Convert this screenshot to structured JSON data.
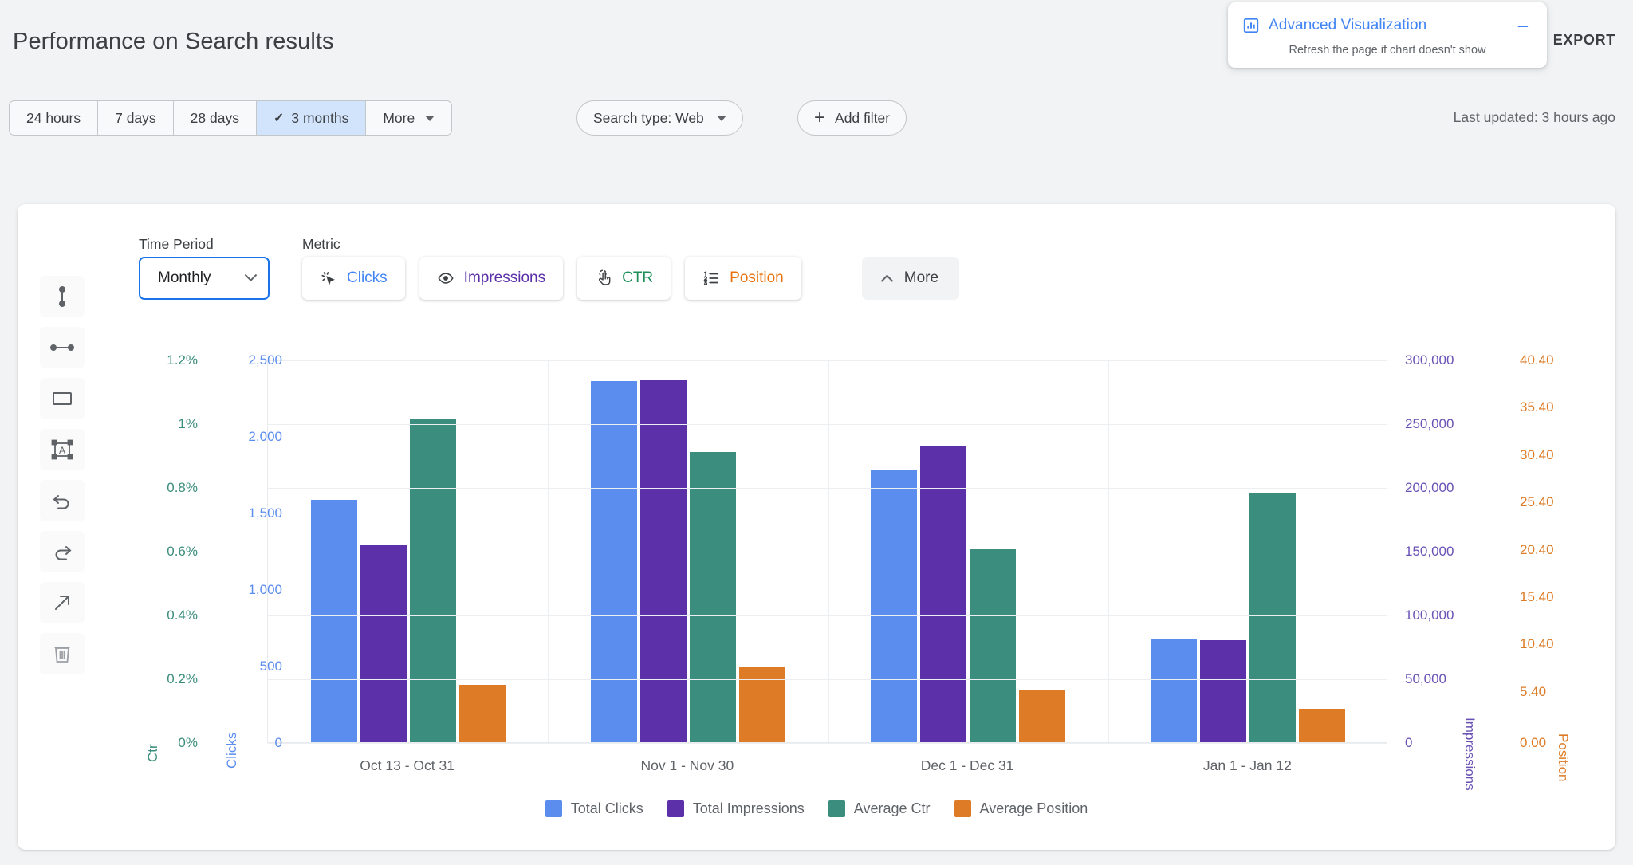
{
  "header": {
    "title": "Performance on Search results",
    "export_label": "EXPORT",
    "advanced_viz": {
      "title": "Advanced Visualization",
      "subtitle": "Refresh the page if chart doesn't show",
      "minimize_label": "–",
      "icon": "bar-chart-icon",
      "accent_color": "#4285f4"
    }
  },
  "filter_bar": {
    "ranges": [
      {
        "label": "24 hours",
        "active": false
      },
      {
        "label": "7 days",
        "active": false
      },
      {
        "label": "28 days",
        "active": false
      },
      {
        "label": "3 months",
        "active": true,
        "check": "✓"
      },
      {
        "label": "More",
        "active": false,
        "caret": true
      }
    ],
    "search_type": {
      "label": "Search type: Web",
      "caret": true
    },
    "add_filter": {
      "label": "Add filter",
      "icon": "plus-icon"
    },
    "last_updated": "Last updated: 3 hours ago"
  },
  "tool_rail": [
    {
      "name": "vertical-line-tool"
    },
    {
      "name": "horizontal-line-tool"
    },
    {
      "name": "rectangle-tool"
    },
    {
      "name": "text-box-tool"
    },
    {
      "name": "undo-tool"
    },
    {
      "name": "redo-tool"
    },
    {
      "name": "arrow-tool"
    },
    {
      "name": "delete-tool"
    }
  ],
  "controls": {
    "time_period_label": "Time Period",
    "time_period_value": "Monthly",
    "metric_label": "Metric",
    "metrics": [
      {
        "label": "Clicks",
        "color": "#4285f4",
        "icon": "cursor-click-icon"
      },
      {
        "label": "Impressions",
        "color": "#5b30a8",
        "icon": "eye-icon"
      },
      {
        "label": "CTR",
        "color": "#1e8e5a",
        "icon": "tap-icon"
      },
      {
        "label": "Position",
        "color": "#e8710a",
        "icon": "ordered-list-icon"
      }
    ],
    "more_label": "More"
  },
  "chart_data": {
    "type": "bar",
    "title": "",
    "categories": [
      "Oct 13 - Oct 31",
      "Nov 1 - Nov 30",
      "Dec 1 - Dec 31",
      "Jan 1 - Jan 12"
    ],
    "grid": true,
    "legend_position": "bottom",
    "series": [
      {
        "name": "Total Clicks",
        "color": "#5b8def",
        "axis": "clicks",
        "values": [
          1583,
          2359,
          1776,
          672
        ]
      },
      {
        "name": "Total Impressions",
        "color": "#5b30a8",
        "axis": "impressions",
        "values": [
          155000,
          284000,
          232000,
          80000
        ]
      },
      {
        "name": "Average Ctr",
        "color": "#3b8d7d",
        "axis": "ctr",
        "values": [
          1.013,
          0.91,
          0.605,
          0.78
        ]
      },
      {
        "name": "Average Position",
        "color": "#dd7b26",
        "axis": "position",
        "values": [
          6.06,
          7.91,
          5.56,
          3.54
        ]
      }
    ],
    "axes": {
      "ctr": {
        "label": "Ctr",
        "color": "#3b8d7d",
        "min": 0,
        "max": 1.2,
        "ticks": [
          "0%",
          "0.2%",
          "0.4%",
          "0.6%",
          "0.8%",
          "1%",
          "1.2%"
        ],
        "tick_values": [
          0,
          0.2,
          0.4,
          0.6,
          0.8,
          1.0,
          1.2
        ]
      },
      "clicks": {
        "label": "Clicks",
        "color": "#5b8def",
        "min": 0,
        "max": 2500,
        "ticks": [
          "0",
          "500",
          "1,000",
          "1,500",
          "2,000",
          "2,500"
        ],
        "tick_values": [
          0,
          500,
          1000,
          1500,
          2000,
          2500
        ]
      },
      "impressions": {
        "label": "Impressions",
        "color": "#6a52b5",
        "min": 0,
        "max": 300000,
        "ticks": [
          "0",
          "50,000",
          "100,000",
          "150,000",
          "200,000",
          "250,000",
          "300,000"
        ],
        "tick_values": [
          0,
          50000,
          100000,
          150000,
          200000,
          250000,
          300000
        ]
      },
      "position": {
        "label": "Position",
        "color": "#dd7b26",
        "min": 0,
        "max": 40.4,
        "ticks": [
          "0.00",
          "5.40",
          "10.40",
          "15.40",
          "20.40",
          "25.40",
          "30.40",
          "35.40",
          "40.40"
        ],
        "tick_values": [
          0,
          5.4,
          10.4,
          15.4,
          20.4,
          25.4,
          30.4,
          35.4,
          40.4
        ]
      }
    }
  }
}
